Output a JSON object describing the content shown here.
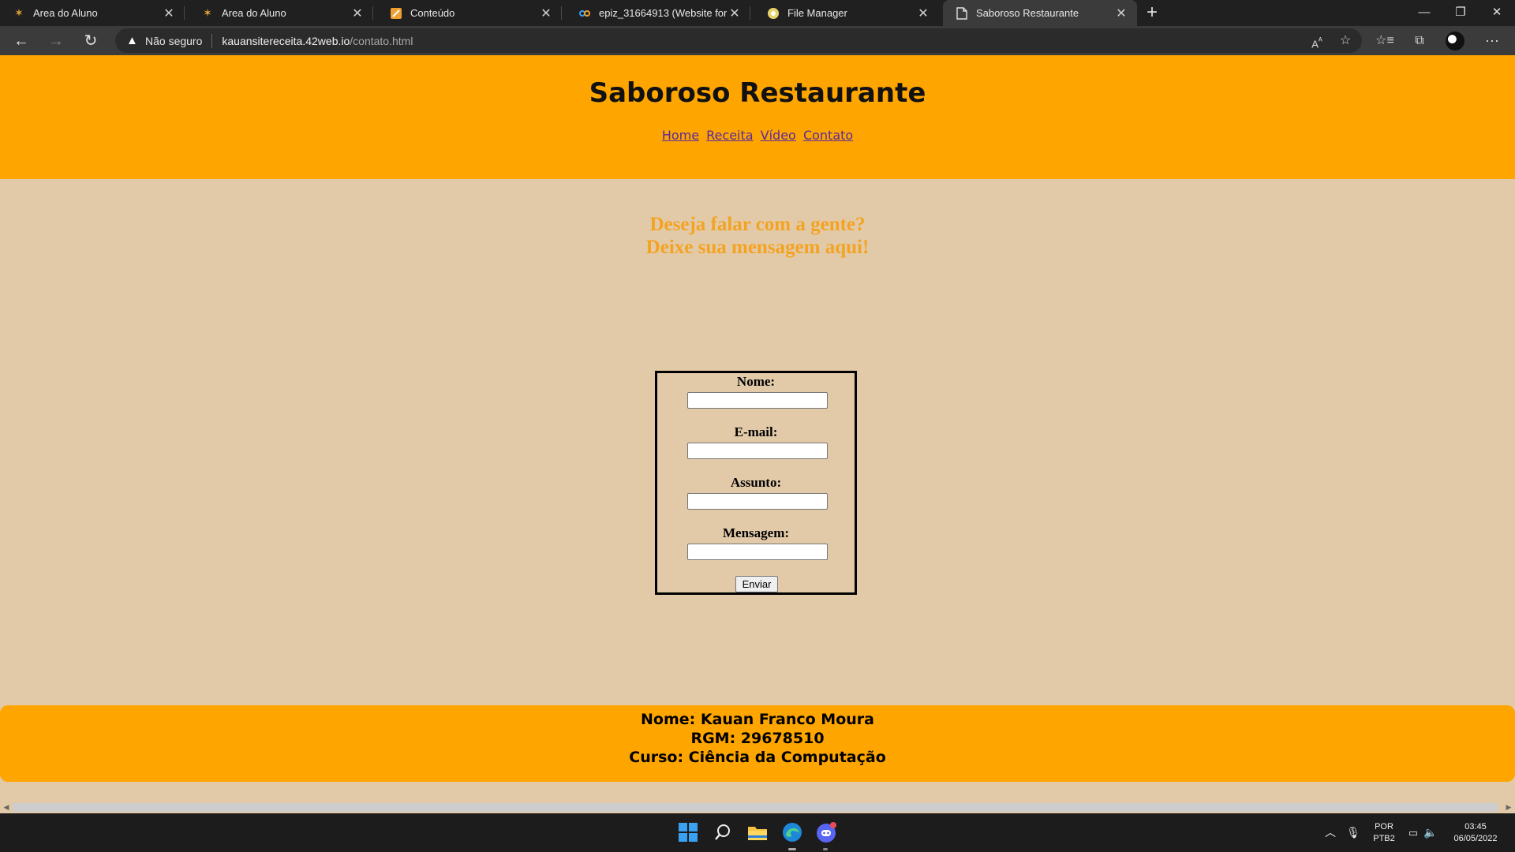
{
  "browser": {
    "tabs": [
      {
        "title": "Area do Aluno",
        "icon": "star-logo-icon"
      },
      {
        "title": "Area do Aluno",
        "icon": "star-logo-icon"
      },
      {
        "title": "Conteúdo",
        "icon": "document-orange-icon"
      },
      {
        "title": "epiz_31664913 (Website for kaua",
        "icon": "cpanel-icon"
      },
      {
        "title": "File Manager",
        "icon": "file-manager-icon"
      },
      {
        "title": "Saboroso Restaurante",
        "icon": "page-icon",
        "active": true
      }
    ],
    "address": {
      "security_label": "Não seguro",
      "host": "kauansitereceita.42web.io",
      "path": "/contato.html"
    }
  },
  "site": {
    "title": "Saboroso Restaurante",
    "nav": [
      "Home",
      "Receita",
      "Vídeo",
      "Contato"
    ],
    "heading_line1": "Deseja falar com a gente?",
    "heading_line2": "Deixe sua mensagem aqui!",
    "form": {
      "fields": [
        "Nome:",
        "E-mail:",
        "Assunto:",
        "Mensagem:"
      ],
      "submit_label": "Enviar"
    },
    "footer": {
      "line1": "Nome: Kauan Franco Moura",
      "line2": "RGM: 29678510",
      "line3": "Curso: Ciência da Computação"
    }
  },
  "taskbar": {
    "language_line1": "POR",
    "language_line2": "PTB2",
    "time": "03:45",
    "date": "06/05/2022"
  },
  "colors": {
    "header_orange": "#ffa500",
    "page_background": "#e2caa9",
    "heading_orange": "#f4a321",
    "nav_link": "#5a2a9c"
  }
}
